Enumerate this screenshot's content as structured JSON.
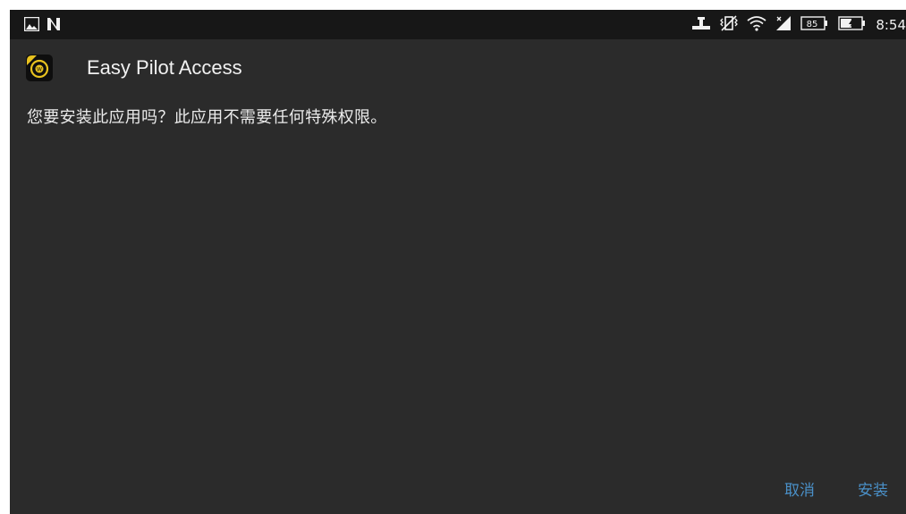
{
  "status_bar": {
    "left_icons": [
      "image-icon",
      "n-icon"
    ],
    "right_icons": [
      "usb-icon",
      "vibrate-icon",
      "wifi-icon",
      "signal-icon",
      "battery-indicator-icon",
      "battery-icon"
    ],
    "battery_level_text": "85",
    "time": "8:54"
  },
  "dialog": {
    "app_icon": "app-icon",
    "app_name": "Easy Pilot Access",
    "message": "您要安装此应用吗？此应用不需要任何特殊权限。",
    "cancel_label": "取消",
    "install_label": "安装"
  },
  "colors": {
    "background": "#2b2b2b",
    "status_bar": "#171717",
    "accent": "#4a90c8"
  }
}
